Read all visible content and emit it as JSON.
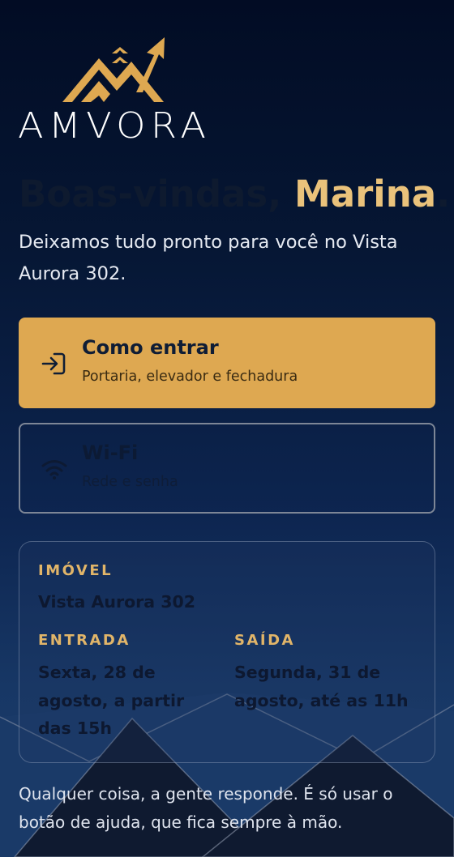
{
  "brand": {
    "name": "AMVORA"
  },
  "greeting": {
    "prefix": "Boas-vindas, ",
    "name": "Marina",
    "suffix": "."
  },
  "intro": "Deixamos tudo pronto para você no Vista Aurora 302.",
  "cards": {
    "enter": {
      "title": "Como entrar",
      "subtitle": "Portaria, elevador e fechadura",
      "icon": "login-icon"
    },
    "wifi": {
      "title": "Wi-Fi",
      "subtitle": "Rede e senha",
      "icon": "wifi-icon"
    }
  },
  "property": {
    "label": "IMÓVEL",
    "name": "Vista Aurora 302",
    "checkin": {
      "label": "ENTRADA",
      "value": "Sexta, 28 de agosto, a partir das 15h"
    },
    "checkout": {
      "label": "SAÍDA",
      "value": "Segunda, 31 de agosto, até as 11h"
    }
  },
  "footer": "Qualquer coisa, a gente responde. É só usar o botão de ajuda, que fica sempre à mão.",
  "colors": {
    "accent": "#DEA851",
    "accent_text": "#EAC27B",
    "background_top": "#020C24",
    "background_bottom": "#1B3C6C"
  }
}
